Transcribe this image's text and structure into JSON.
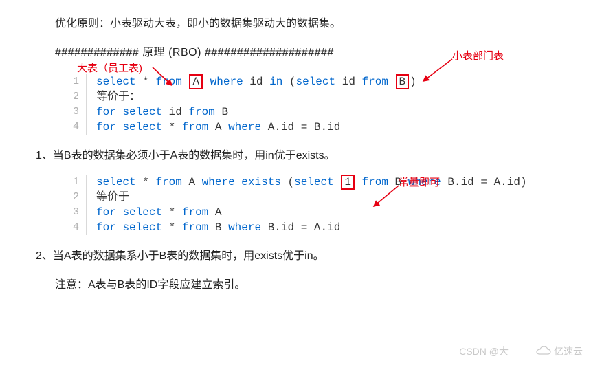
{
  "paragraphs": {
    "principle": "优化原则：小表驱动大表，即小的数据集驱动大的数据集。",
    "hashline_pre": "#############",
    "hashline_mid": " 原理 (RBO) ",
    "hashline_post": "####################",
    "rule1": "1、当B表的数据集必须小于A表的数据集时，用in优于exists。",
    "rule2": "2、当A表的数据集系小于B表的数据集时，用exists优于in。",
    "note": "注意：A表与B表的ID字段应建立索引。"
  },
  "annotations": {
    "big_table": "大表（员工表)",
    "small_table": "小表部门表",
    "constant": "常量即可"
  },
  "code1": {
    "lines": [
      "1",
      "2",
      "3",
      "4"
    ],
    "l1": {
      "kw_select": "select",
      "star": " * ",
      "kw_from": "from",
      "sp1": " ",
      "boxA": "A",
      "sp2": " ",
      "kw_where": "where",
      "txt_id": " id ",
      "kw_in": "in",
      "sp3": " (",
      "kw_select2": "select",
      "txt_id2": " id ",
      "kw_from2": "from",
      "sp4": " ",
      "boxB": "B",
      "close": ")"
    },
    "l2": "等价于：",
    "l3": {
      "kw_for": "for",
      "sp": " ",
      "kw_select": "select",
      "rest": " id ",
      "kw_from": "from",
      "rest2": " B"
    },
    "l4": {
      "kw_for": "for",
      "sp": " ",
      "kw_select": "select",
      "rest": " * ",
      "kw_from": "from",
      "rest2": " A ",
      "kw_where": "where",
      "rest3": " A.id = B.id"
    }
  },
  "code2": {
    "lines": [
      "1",
      "2",
      "3",
      "4"
    ],
    "l1": {
      "kw_select": "select",
      "star": " * ",
      "kw_from": "from",
      "mid": " A ",
      "kw_where": "where",
      "sp": " ",
      "kw_exists": "exists",
      "sp2": " (",
      "kw_select2": "select",
      "sp3": " ",
      "box1": "1",
      "sp4": " ",
      "kw_from2": "from",
      "mid2": " B ",
      "kw_where2": "where",
      "rest": " B.id = A.id)"
    },
    "l2": "等价于",
    "l3": {
      "kw_for": "for",
      "sp": " ",
      "kw_select": "select",
      "rest": " * ",
      "kw_from": "from",
      "rest2": " A"
    },
    "l4": {
      "kw_for": "for",
      "sp": " ",
      "kw_select": "select",
      "rest": " * ",
      "kw_from": "from",
      "rest2": " B ",
      "kw_where": "where",
      "rest3": " B.id = A.id"
    }
  },
  "watermark": {
    "mid": "CSDN @大",
    "right": "亿速云"
  }
}
